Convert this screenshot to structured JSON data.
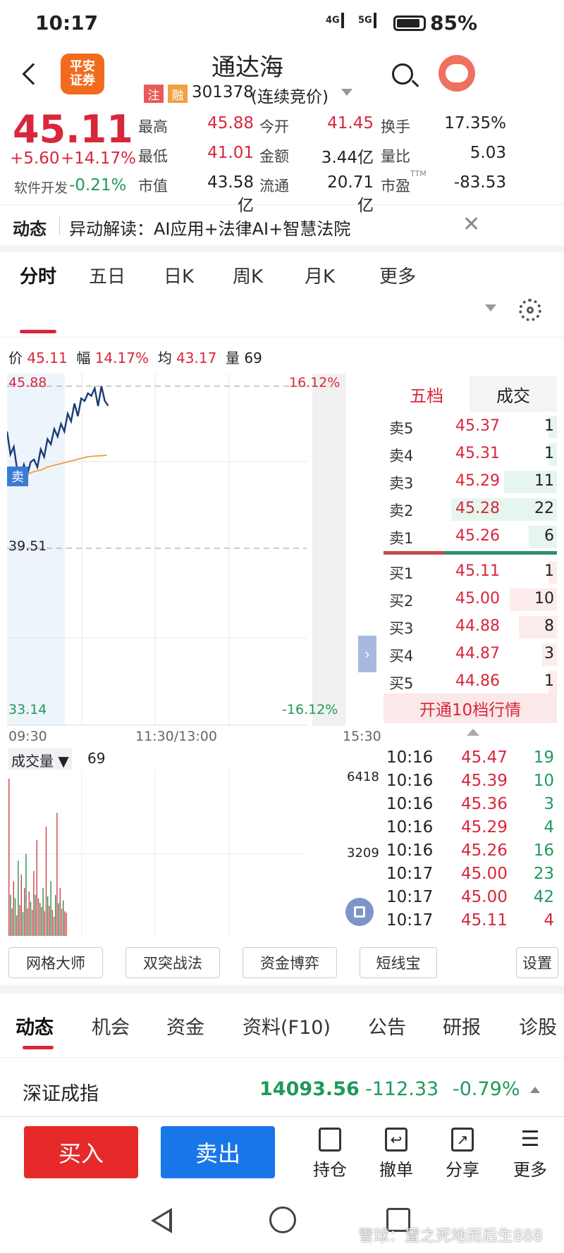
{
  "status": {
    "time": "10:17",
    "net1": "4G",
    "net2": "5G",
    "battery": "85%"
  },
  "header": {
    "app_logo": "平安\n证券",
    "title": "通达海",
    "tag1": "注",
    "tag2": "融",
    "code": "301378",
    "mode": "(连续竞价)"
  },
  "quote": {
    "price": "45.11",
    "change": "+5.60",
    "pct": "+14.17%",
    "sector": "软件开发",
    "sector_pct": "-0.21%",
    "stats": [
      {
        "label": "最高",
        "value": "45.88",
        "color": "red"
      },
      {
        "label": "今开",
        "value": "41.45",
        "color": "red"
      },
      {
        "label": "换手",
        "value": "17.35%",
        "color": "dark"
      },
      {
        "label": "最低",
        "value": "41.01",
        "color": "red"
      },
      {
        "label": "金额",
        "value": "3.44亿",
        "color": "dark"
      },
      {
        "label": "量比",
        "value": "5.03",
        "color": "dark"
      },
      {
        "label": "市值",
        "value": "43.58亿",
        "color": "dark"
      },
      {
        "label": "流通",
        "value": "20.71亿",
        "color": "dark"
      },
      {
        "label": "市盈",
        "value": "-83.53",
        "color": "dark",
        "sup": "TTM"
      }
    ]
  },
  "news": {
    "label": "动态",
    "text": "异动解读：AI应用+法律AI+智慧法院"
  },
  "chart_tabs": [
    "分时",
    "五日",
    "日K",
    "周K",
    "月K",
    "更多"
  ],
  "info_bar": {
    "p_label": "价",
    "p": "45.11",
    "f_label": "幅",
    "f": "14.17%",
    "a_label": "均",
    "a": "43.17",
    "v_label": "量",
    "v": "69"
  },
  "chart_axis": {
    "top": "45.88",
    "top_pct": "16.12%",
    "mid": "39.51",
    "bottom": "33.14",
    "bottom_pct": "-16.12%",
    "t1": "09:30",
    "t2": "11:30/13:00",
    "t3": "15:30",
    "sell_tag": "卖"
  },
  "chart_data": {
    "type": "line",
    "x_range": [
      "09:30",
      "15:30"
    ],
    "ylim": [
      33.14,
      45.88
    ],
    "series": [
      {
        "color": "#1a3a7a",
        "values": [
          44.1,
          43.2,
          43.5,
          42.6,
          42.3,
          42.8,
          42.4,
          42.9,
          43.0,
          42.7,
          43.4,
          43.1,
          43.8,
          43.6,
          44.2,
          43.9,
          44.4,
          44.1,
          44.8,
          44.5,
          45.2,
          44.7,
          45.4,
          45.3,
          45.6,
          45.5,
          45.8,
          45.1,
          45.88,
          45.3,
          45.11
        ]
      },
      {
        "color": "#e8a33d",
        "values": [
          42.0,
          42.1,
          42.2,
          42.3,
          42.4,
          42.5,
          42.55,
          42.6,
          42.7,
          42.75,
          42.8,
          42.85,
          42.9,
          42.95,
          43.0,
          43.05,
          43.1,
          43.12,
          43.14,
          43.15,
          43.17
        ]
      }
    ]
  },
  "order_book": {
    "tab1": "五档",
    "tab2": "成交",
    "asks": [
      {
        "l": "卖5",
        "p": "45.37",
        "q": "1",
        "bar": 0.08
      },
      {
        "l": "卖4",
        "p": "45.31",
        "q": "1",
        "bar": 0.08
      },
      {
        "l": "卖3",
        "p": "45.29",
        "q": "11",
        "bar": 0.5
      },
      {
        "l": "卖2",
        "p": "45.28",
        "q": "22",
        "bar": 1.0
      },
      {
        "l": "卖1",
        "p": "45.26",
        "q": "6",
        "bar": 0.27
      }
    ],
    "bids": [
      {
        "l": "买1",
        "p": "45.11",
        "q": "1",
        "bar": 0.08
      },
      {
        "l": "买2",
        "p": "45.00",
        "q": "10",
        "bar": 0.45
      },
      {
        "l": "买3",
        "p": "44.88",
        "q": "8",
        "bar": 0.36
      },
      {
        "l": "买4",
        "p": "44.87",
        "q": "3",
        "bar": 0.14
      },
      {
        "l": "买5",
        "p": "44.86",
        "q": "1",
        "bar": 0.08
      }
    ],
    "open10": "开通10档行情"
  },
  "volume": {
    "label": "成交量",
    "value": "69",
    "y1": "6418",
    "y2": "3209"
  },
  "trades": [
    {
      "t": "10:16",
      "p": "45.47",
      "q": "19",
      "qc": "green"
    },
    {
      "t": "10:16",
      "p": "45.39",
      "q": "10",
      "qc": "green"
    },
    {
      "t": "10:16",
      "p": "45.36",
      "q": "3",
      "qc": "green"
    },
    {
      "t": "10:16",
      "p": "45.29",
      "q": "4",
      "qc": "green"
    },
    {
      "t": "10:16",
      "p": "45.26",
      "q": "16",
      "qc": "green"
    },
    {
      "t": "10:17",
      "p": "45.00",
      "q": "23",
      "qc": "green"
    },
    {
      "t": "10:17",
      "p": "45.00",
      "q": "42",
      "qc": "green"
    },
    {
      "t": "10:17",
      "p": "45.11",
      "q": "4",
      "qc": "red"
    }
  ],
  "tools": [
    "网格大师",
    "双突战法",
    "资金博弈",
    "短线宝",
    "设置"
  ],
  "bottom_tabs": [
    "动态",
    "机会",
    "资金",
    "资料(F10)",
    "公告",
    "研报",
    "诊股"
  ],
  "index": {
    "name": "深证成指",
    "value": "14093.56",
    "change": "-112.33",
    "pct": "-0.79%"
  },
  "actions": {
    "buy": "买入",
    "sell": "卖出",
    "hold": "持仓",
    "cancel": "撤单",
    "share": "分享",
    "more": "更多"
  },
  "watermark": "雪球：置之死地而后生888"
}
